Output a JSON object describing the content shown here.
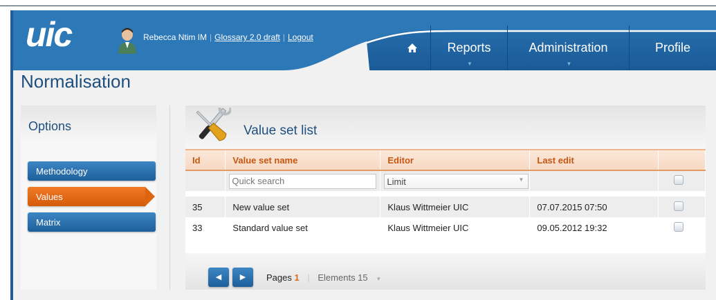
{
  "header": {
    "logo_text": "uic",
    "user_name": "Rebecca Ntim IM",
    "glossary_link": "Glossary 2.0 draft",
    "logout_link": "Logout",
    "nav": [
      {
        "label": "",
        "icon": "home-icon"
      },
      {
        "label": "Reports"
      },
      {
        "label": "Administration"
      },
      {
        "label": "Profile"
      }
    ],
    "colors": {
      "brand_blue": "#1d5f9a",
      "accent_orange": "#e06a15"
    }
  },
  "page": {
    "title": "Normalisation"
  },
  "sidebar": {
    "heading": "Options",
    "items": [
      {
        "label": "Methodology",
        "active": false
      },
      {
        "label": "Values",
        "active": true
      },
      {
        "label": "Matrix",
        "active": false
      }
    ]
  },
  "main": {
    "title": "Value set list",
    "columns": [
      "Id",
      "Value set name",
      "Editor",
      "Last edit"
    ],
    "filter": {
      "search_placeholder": "Quick search",
      "limit_label": "Limit"
    },
    "rows": [
      {
        "id": "35",
        "name": "New value set",
        "editor": "Klaus Wittmeier UIC",
        "last_edit": "07.07.2015 07:50"
      },
      {
        "id": "33",
        "name": "Standard value set",
        "editor": "Klaus Wittmeier UIC",
        "last_edit": "09.05.2012 19:32"
      }
    ],
    "pagination": {
      "pages_label": "Pages",
      "current_page": "1",
      "elements_label": "Elements 15"
    }
  }
}
